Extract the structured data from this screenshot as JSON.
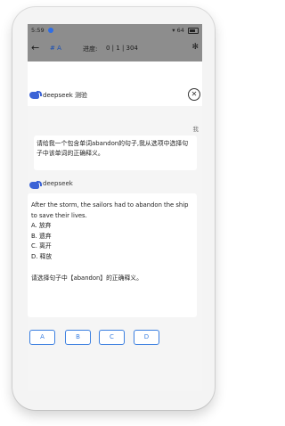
{
  "status": {
    "time": "5:59",
    "battery": "64"
  },
  "toolbar": {
    "hash": "# A",
    "progress_label": "进度:",
    "progress_value": "0 | 1 | 304"
  },
  "header": {
    "title": "deepseek 测验"
  },
  "chat": {
    "me_label": "我",
    "user_message": "请给我一个包含单词abandon的句子,我从选项中选择句子中该单词的正确释义。",
    "bot_name": "deepseek",
    "sentence": "After the storm, the sailors had to abandon the ship to save their lives.",
    "choices": [
      "A. 放弃",
      "B. 遗弃",
      "C. 离开",
      "D. 释放"
    ],
    "prompt": "请选择句子中【abandon】的正确释义。"
  },
  "options": [
    "A",
    "B",
    "C",
    "D"
  ],
  "colors": {
    "accent": "#3b7fe0",
    "toolbar": "#8d8d8d",
    "brand": "#3b63d6"
  }
}
